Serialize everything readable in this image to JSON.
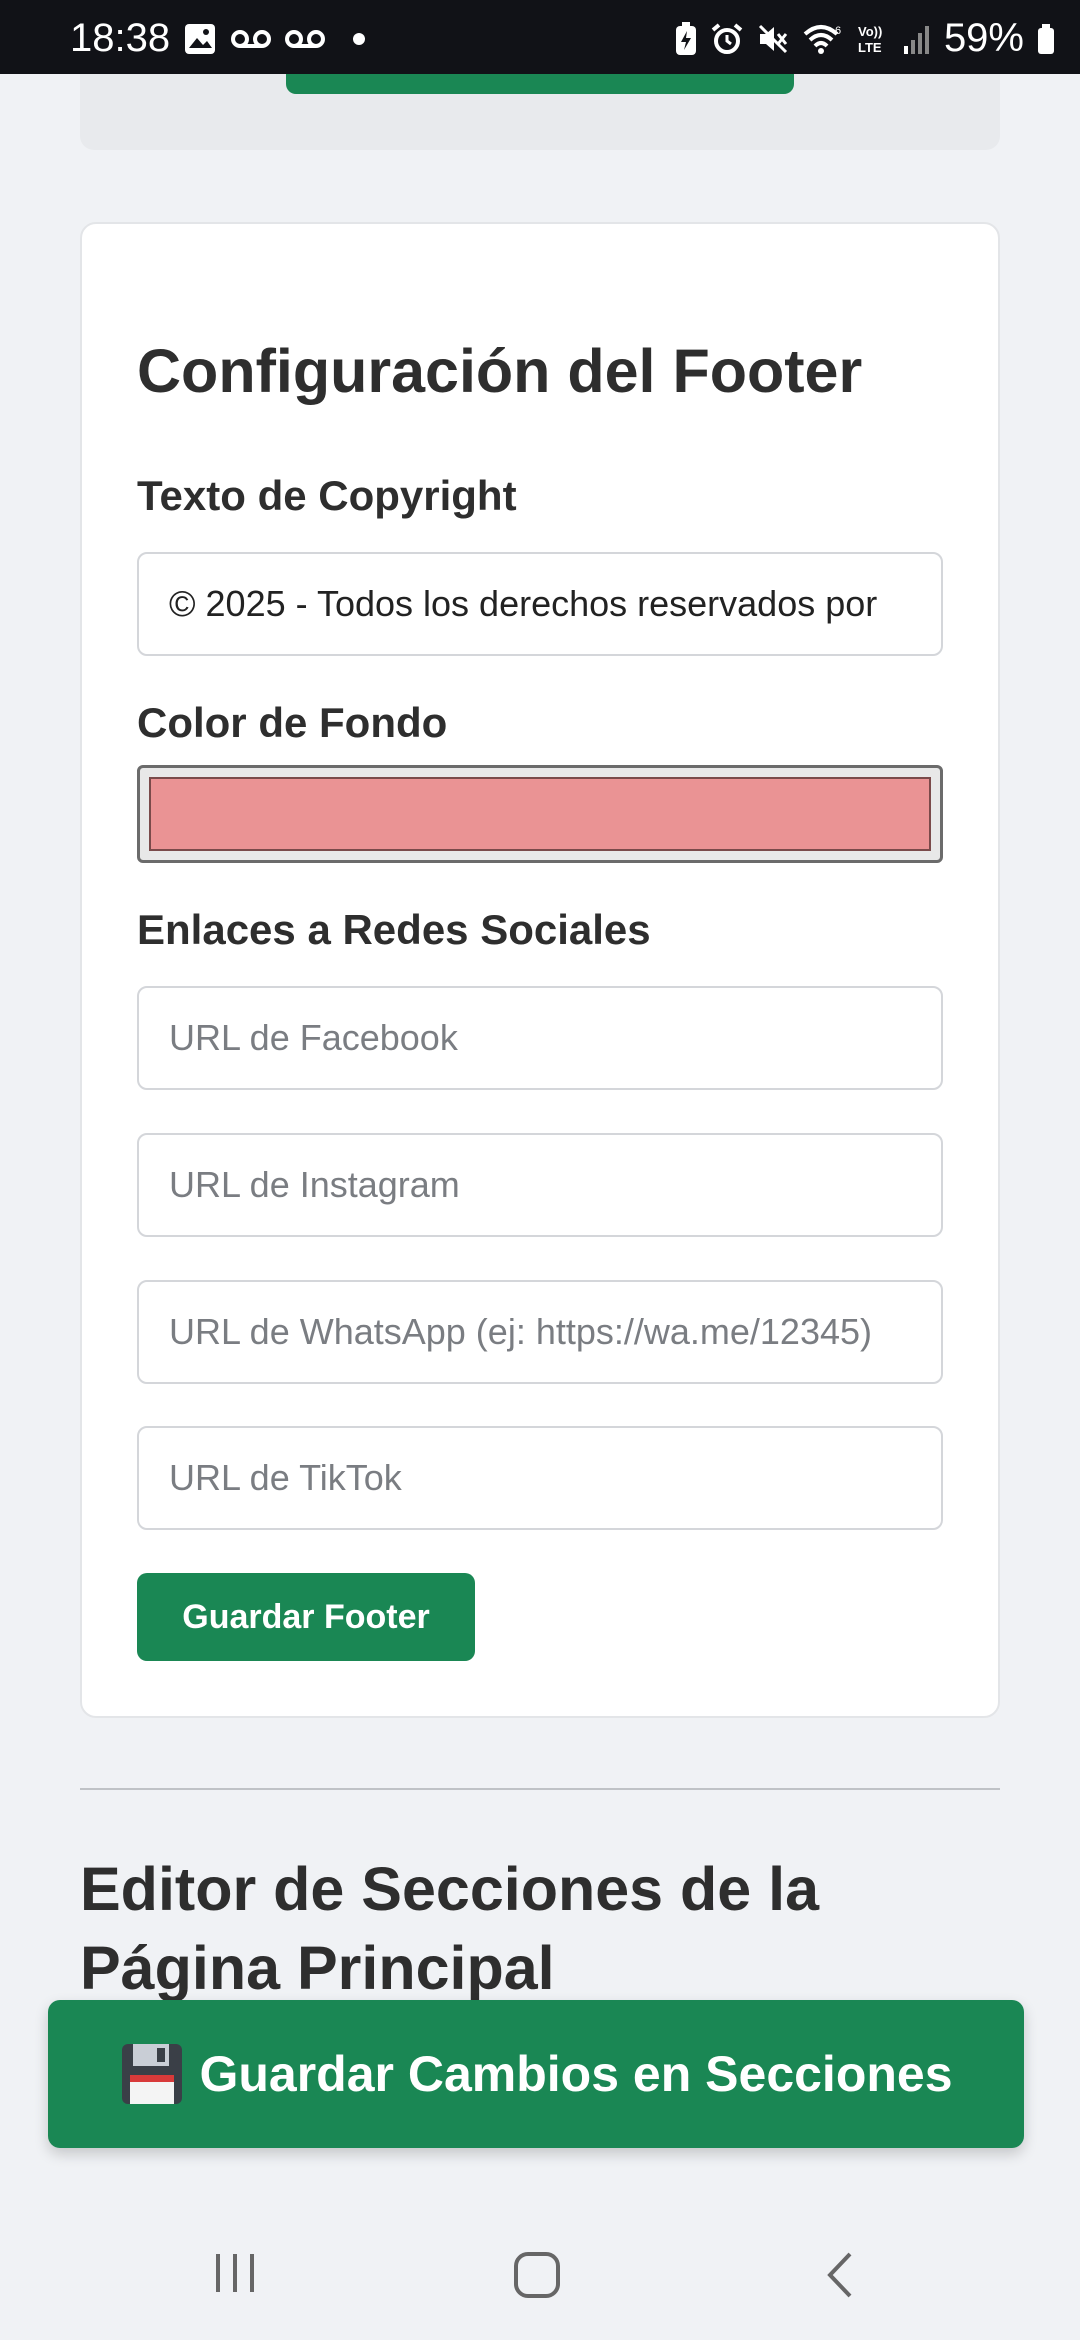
{
  "status_bar": {
    "time": "18:38",
    "battery_percent": "59%",
    "icons": [
      "image-icon",
      "voicemail-icon",
      "voicemail-icon",
      "dot-icon",
      "battery-saver-icon",
      "alarm-icon",
      "mute-icon",
      "wifi-icon",
      "volte-icon",
      "signal-icon",
      "battery-icon"
    ]
  },
  "footer_config": {
    "title": "Configuración del Footer",
    "copyright_label": "Texto de Copyright",
    "copyright_value": "© 2025 - Todos los derechos reservados por",
    "bg_color_label": "Color de Fondo",
    "bg_color_value": "#ea9394",
    "social_label": "Enlaces a Redes Sociales",
    "facebook_placeholder": "URL de Facebook",
    "instagram_placeholder": "URL de Instagram",
    "whatsapp_placeholder": "URL de WhatsApp (ej: https://wa.me/12345)",
    "tiktok_placeholder": "URL de TikTok",
    "save_label": "Guardar Footer"
  },
  "sections_editor": {
    "title": "Editor de Secciones de la Página Principal",
    "save_label": "Guardar Cambios en Secciones",
    "save_icon": "floppy-disk-icon"
  },
  "colors": {
    "accent": "#1a8754",
    "background": "#f0f2f5"
  }
}
